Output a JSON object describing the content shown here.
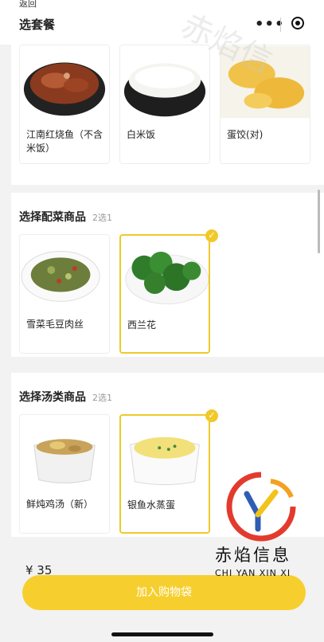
{
  "header": {
    "crumb": "返回",
    "title": "选套餐",
    "more_glyph": "•••"
  },
  "main_dishes": {
    "items": [
      {
        "name": "江南红烧鱼（不含米饭）",
        "image": "braised-fish-bowl"
      },
      {
        "name": "白米饭",
        "image": "rice-bowl"
      },
      {
        "name": "蛋饺(对)",
        "image": "egg-dumplings"
      }
    ]
  },
  "side_dishes": {
    "title": "选择配菜商品",
    "hint": "2选1",
    "items": [
      {
        "name": "雪菜毛豆肉丝",
        "selected": false,
        "image": "vegetable-stir-fry"
      },
      {
        "name": "西兰花",
        "selected": true,
        "image": "broccoli"
      }
    ]
  },
  "soups": {
    "title": "选择汤类商品",
    "hint": "2选1",
    "items": [
      {
        "name": "鲜炖鸡汤（新）",
        "selected": false,
        "image": "chicken-soup"
      },
      {
        "name": "银鱼水蒸蛋",
        "selected": true,
        "image": "steamed-egg"
      }
    ]
  },
  "footer": {
    "price": "¥ 35",
    "cart_button": "加入购物袋"
  },
  "brand": {
    "name_cn": "赤焰信息",
    "name_en": "CHI YAN XIN XI",
    "watermark": "赤焰信"
  },
  "colors": {
    "accent": "#f6cf2e",
    "selected_border": "#f0c92a",
    "background": "#f2f2f2"
  },
  "icons": {
    "check": "✓"
  }
}
